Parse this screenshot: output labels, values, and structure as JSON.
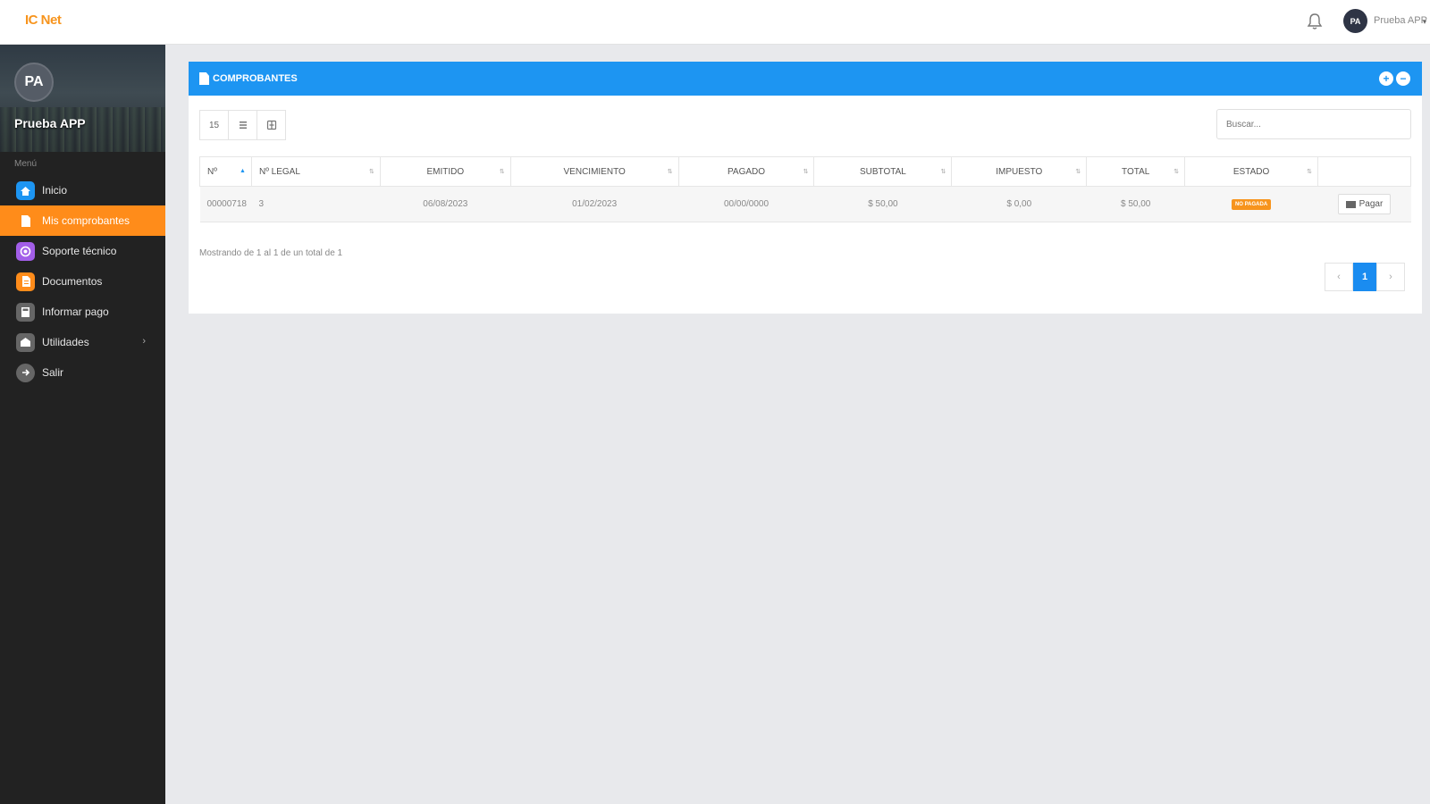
{
  "app": {
    "logo_text": "IC Net",
    "user_initials": "PA",
    "user_name": "Prueba APP"
  },
  "sidebar": {
    "profile_name": "Prueba APP",
    "profile_initials": "PA",
    "menu_label": "Menú",
    "items": [
      {
        "label": "Inicio",
        "icon": "home-icon",
        "color": "#1d95f2"
      },
      {
        "label": "Mis comprobantes",
        "icon": "document-icon",
        "color": "#ff8c1a"
      },
      {
        "label": "Soporte técnico",
        "icon": "support-icon",
        "color": "#a25ee8"
      },
      {
        "label": "Documentos",
        "icon": "file-icon",
        "color": "#ff8c1a"
      },
      {
        "label": "Informar pago",
        "icon": "calculator-icon",
        "color": "#666666"
      },
      {
        "label": "Utilidades",
        "icon": "utilities-icon",
        "color": "#666666"
      },
      {
        "label": "Salir",
        "icon": "logout-icon",
        "color": "#666666"
      }
    ]
  },
  "panel": {
    "title": "COMPROBANTES",
    "toolbar": {
      "page_size": "15"
    },
    "search_placeholder": "Buscar...",
    "columns": [
      "Nº",
      "Nº LEGAL",
      "EMITIDO",
      "VENCIMIENTO",
      "PAGADO",
      "SUBTOTAL",
      "IMPUESTO",
      "TOTAL",
      "ESTADO"
    ],
    "rows": [
      {
        "num": "00000718",
        "legal": "3",
        "emitido": "06/08/2023",
        "vencimiento": "01/02/2023",
        "pagado": "00/00/0000",
        "subtotal": "$ 50,00",
        "impuesto": "$ 0,00",
        "total": "$ 50,00",
        "estado": "NO PAGADA",
        "action": "Pagar"
      }
    ],
    "info_text": "Mostrando de 1 al 1 de un total de 1",
    "pagination": {
      "current": "1",
      "prev": "‹",
      "next": "›"
    }
  },
  "colors": {
    "accent": "#1d95f2",
    "active": "#ff8c1a",
    "badge": "#f7941d"
  }
}
